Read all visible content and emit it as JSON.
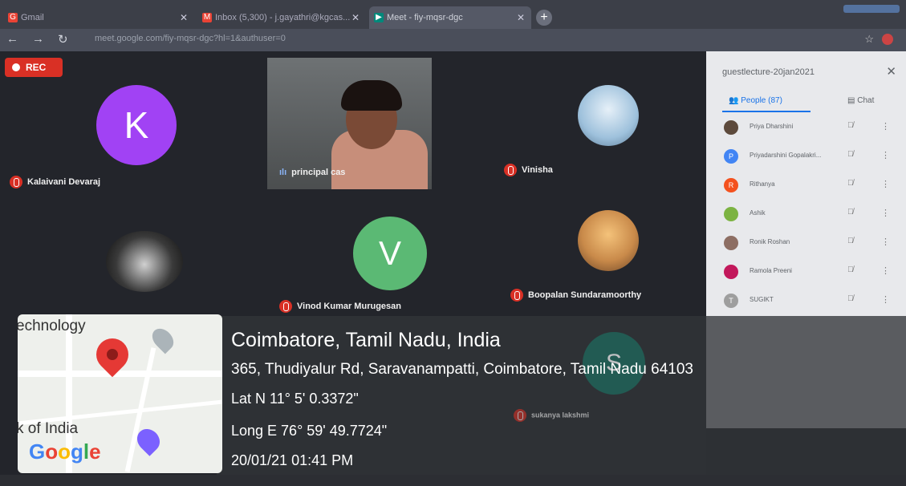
{
  "browser": {
    "tabs": [
      {
        "label": "Gmail",
        "icon": "gmail-icon"
      },
      {
        "label": "Inbox (5,300) - j.gayathri@kgcas...",
        "icon": "gmail-icon"
      },
      {
        "label": "Meet - fiy-mqsr-dgc",
        "icon": "meet-icon"
      }
    ],
    "url": "meet.google.com/fiy-mqsr-dgc?hl=1&authuser=0"
  },
  "meet": {
    "rec_label": "REC",
    "participants": [
      {
        "name": "Kalaivani Devaraj",
        "initial": "K",
        "color": "#a142f4"
      },
      {
        "name": "principal cas",
        "initial": ""
      },
      {
        "name": "Vinisha",
        "initial": ""
      },
      {
        "name": "",
        "initial": ""
      },
      {
        "name": "Vinod Kumar Murugesan",
        "initial": "V",
        "color": "#5bb974"
      },
      {
        "name": "Boopalan Sundaramoorthy",
        "initial": ""
      }
    ],
    "bottom_names": [
      "sukanya lakshmi"
    ],
    "bottom_s_initial": "S"
  },
  "panel": {
    "meeting_title": "guestlecture-20jan2021",
    "people_tab": "People (87)",
    "chat_tab": "Chat",
    "people": [
      {
        "name": "Priya Dharshini",
        "initial": "",
        "color": "#5d4a3c"
      },
      {
        "name": "Priyadarshini Gopalakri...",
        "initial": "P",
        "color": "#4285f4"
      },
      {
        "name": "Rithanya",
        "initial": "R",
        "color": "#f4511e"
      },
      {
        "name": "Ashik",
        "initial": "",
        "color": "#7cb342"
      },
      {
        "name": "Ronik Roshan",
        "initial": "",
        "color": "#8d6e63"
      },
      {
        "name": "Ramola Preeni",
        "initial": "",
        "color": "#c2185b"
      },
      {
        "name": "SUGIKT",
        "initial": "T",
        "color": "#9e9e9e"
      }
    ]
  },
  "gps": {
    "city": "Coimbatore, Tamil Nadu, India",
    "address": "365, Thudiyalur Rd, Saravanampatti, Coimbatore, Tamil Nadu 64103",
    "lat": "Lat N 11° 5' 0.3372\"",
    "long": "Long E 76° 59' 49.7724\"",
    "datetime": "20/01/21 01:41 PM",
    "map_top_text": "echnology",
    "map_bottom_text": "k of India",
    "google_logo": "Google"
  }
}
